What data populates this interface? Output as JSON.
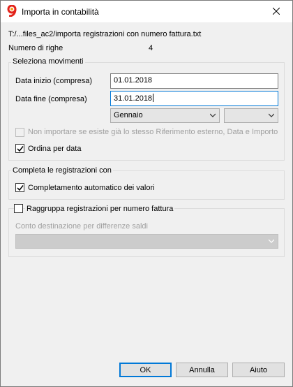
{
  "window": {
    "title": "Importa in contabilità"
  },
  "info": {
    "file_path": "T:/...files_ac2/importa registrazioni con numero fattura.txt",
    "rows_label": "Numero di righe",
    "rows_value": "4"
  },
  "seleziona": {
    "title": "Seleziona movimenti",
    "start_label": "Data inizio (compresa)",
    "start_value": "01.01.2018",
    "end_label": "Data fine (compresa)",
    "end_value": "31.01.2018",
    "month_value": "Gennaio",
    "second_combo_value": "",
    "skip_duplicates_label": "Non importare se esiste già lo stesso Riferimento esterno, Data e Importo",
    "skip_duplicates_checked": false,
    "sort_by_date_label": "Ordina per data",
    "sort_by_date_checked": true
  },
  "completa": {
    "title": "Completa le registrazioni con",
    "auto_complete_label": "Completamento automatico dei valori",
    "auto_complete_checked": true
  },
  "raggruppa": {
    "label": "Raggruppa registrazioni per numero fattura",
    "checked": false,
    "account_label": "Conto destinazione per differenze saldi",
    "account_value": ""
  },
  "buttons": {
    "ok": "OK",
    "cancel": "Annulla",
    "help": "Aiuto"
  },
  "colors": {
    "accent": "#0078d7",
    "app_icon": "#e2231a"
  }
}
